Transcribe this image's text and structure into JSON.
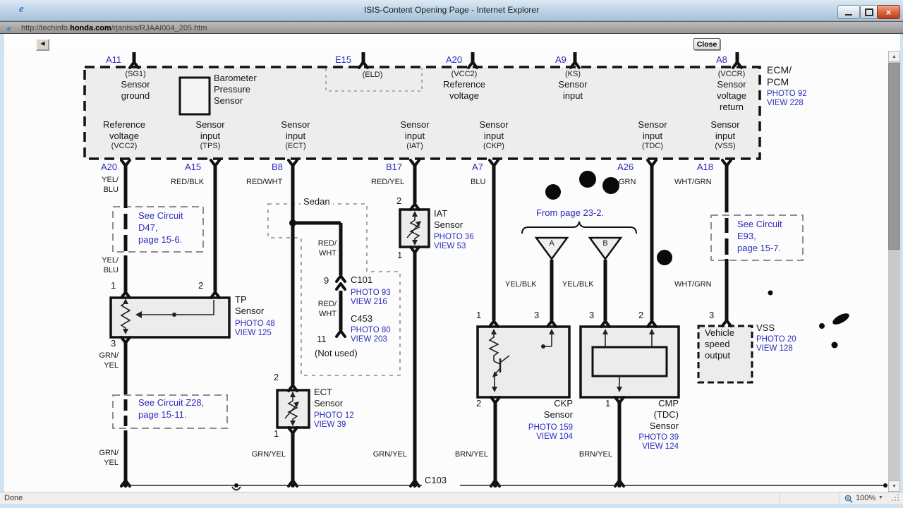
{
  "window": {
    "title": "ISIS-Content Opening Page - Internet Explorer"
  },
  "icons": {
    "back": "◀",
    "scroll_up": "▲",
    "scroll_down": "▼",
    "caret": "▼",
    "close_x": "×",
    "ie_logo": "e"
  },
  "address": {
    "prefix": "http://techinfo.",
    "domain": "honda.com",
    "path": "/rjanisis/RJAAI004_205.htm"
  },
  "toolbar": {
    "close": "Close"
  },
  "statusbar": {
    "text": "Done",
    "zoom": "100%"
  },
  "diagram": {
    "ecm": {
      "name": "ECM/\nPCM",
      "ref": "PHOTO 92\nVIEW 228",
      "top_pins": [
        "A11",
        "E15",
        "A20",
        "A9",
        "A8"
      ],
      "sg1_code": "(SG1)",
      "sg1": "Sensor\nground",
      "baro": "Barometer\nPressure\nSensor",
      "eld": "(ELD)",
      "vcc2_code": "(VCC2)",
      "vcc2": "Reference\nvoltage",
      "ks_code": "(KS)",
      "ks": "Sensor\ninput",
      "vccr_code": "(VCCR)",
      "vccr": "Sensor\nvoltage\nreturn",
      "bottom_fns": [
        {
          "t": "Reference\nvoltage",
          "c": "(VCC2)"
        },
        {
          "t": "Sensor\ninput",
          "c": "(TPS)"
        },
        {
          "t": "Sensor\ninput",
          "c": "(ECT)"
        },
        {
          "t": "Sensor\ninput",
          "c": "(IAT)"
        },
        {
          "t": "Sensor\ninput",
          "c": "(CKP)"
        },
        {
          "t": "Sensor\ninput",
          "c": "(TDC)"
        },
        {
          "t": "Sensor\ninput",
          "c": "(VSS)"
        }
      ],
      "bottom_pins": [
        "A20",
        "A15",
        "B8",
        "B17",
        "A7",
        "A26",
        "A18"
      ],
      "wire_colors": [
        "YEL/\nBLU",
        "RED/BLK",
        "RED/WHT",
        "RED/YEL",
        "BLU",
        "GRN",
        "WHT/GRN"
      ]
    },
    "refs": {
      "d47": "See Circuit\nD47,\npage 15-6.",
      "z28": "See Circuit Z28,\npage 15-11.",
      "e93": "See Circuit\nE93,\npage 15-7.",
      "from_page": "From page 23-2."
    },
    "tp": {
      "name": "TP\nSensor",
      "ref": "PHOTO 48\nVIEW 125",
      "pins": [
        "1",
        "2",
        "3"
      ],
      "wire_in": "YEL/\nBLU",
      "wire_out": "GRN/\nYEL",
      "wire_bottom": "GRN/\nYEL"
    },
    "sedan": {
      "label": "Sedan",
      "wire1": "RED/\nWHT",
      "wire2": "RED/\nWHT",
      "pin9": "9",
      "pin11": "11",
      "c101": "C101",
      "c101_ref": "PHOTO 93\nVIEW 216",
      "c453": "C453",
      "c453_ref": "PHOTO 80\nVIEW 203",
      "not_used": "(Not used)"
    },
    "ect": {
      "name": "ECT\nSensor",
      "ref": "PHOTO 12\nVIEW 39",
      "pin_top": "2",
      "pin_bottom": "1",
      "wire_out": "GRN/YEL"
    },
    "iat": {
      "name": "IAT\nSensor",
      "ref": "PHOTO 36\nVIEW 53",
      "pin_top": "2",
      "pin_bottom": "1",
      "wire_out": "GRN/YEL"
    },
    "ckp": {
      "name": "CKP\nSensor",
      "ref": "PHOTO 159\nVIEW 104",
      "pin1": "1",
      "pin3": "3",
      "pin2": "2",
      "tri": "A",
      "tri_wire": "YEL/BLK",
      "wire_out": "BRN/YEL"
    },
    "cmp": {
      "name": "CMP\n(TDC)\nSensor",
      "ref": "PHOTO 39\nVIEW 124",
      "pin3": "3",
      "pin2": "2",
      "pin1": "1",
      "tri": "B",
      "tri_wire": "YEL/BLK",
      "wire_out": "BRN/YEL"
    },
    "vss": {
      "name": "VSS",
      "ref": "PHOTO 20\nVIEW 128",
      "box": "Vehicle\nspeed\noutput",
      "pin": "3",
      "wire": "WHT/GRN"
    },
    "c103": "C103"
  }
}
